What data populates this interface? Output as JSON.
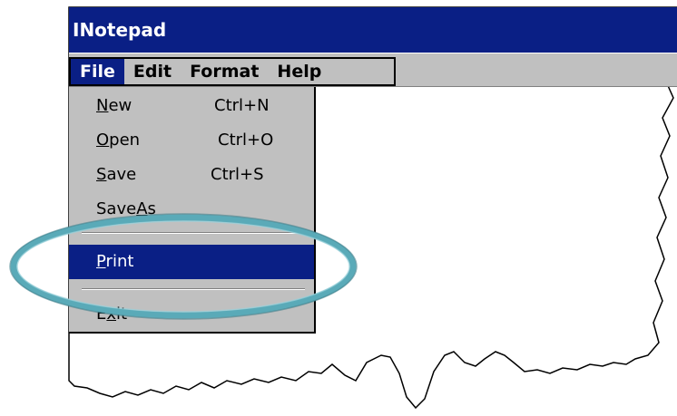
{
  "window": {
    "title": "INotepad"
  },
  "menubar": {
    "items": [
      {
        "label": "File",
        "active": true
      },
      {
        "label": "Edit",
        "active": false
      },
      {
        "label": "Format",
        "active": false
      },
      {
        "label": "Help",
        "active": false
      }
    ]
  },
  "file_menu": {
    "new": {
      "label_mnemonic": "N",
      "label_rest": "ew",
      "shortcut": "Ctrl+N"
    },
    "open": {
      "label_mnemonic": "O",
      "label_rest": "pen",
      "shortcut": "Ctrl+O"
    },
    "save": {
      "label_mnemonic": "S",
      "label_rest": "ave",
      "shortcut": "Ctrl+S"
    },
    "saveas": {
      "label_pre": "Save",
      "label_mnemonic": "A",
      "label_rest": "s"
    },
    "print": {
      "label_mnemonic": "P",
      "label_rest": "rint",
      "selected": true
    },
    "exit": {
      "label_pre": "E",
      "label_mnemonic": "x",
      "label_rest": "it"
    }
  },
  "colors": {
    "titlebar": "#0a1f85",
    "selection": "#0a1f85",
    "menu_background": "#c0c0c0",
    "highlight_ring": "#5aaab8"
  }
}
